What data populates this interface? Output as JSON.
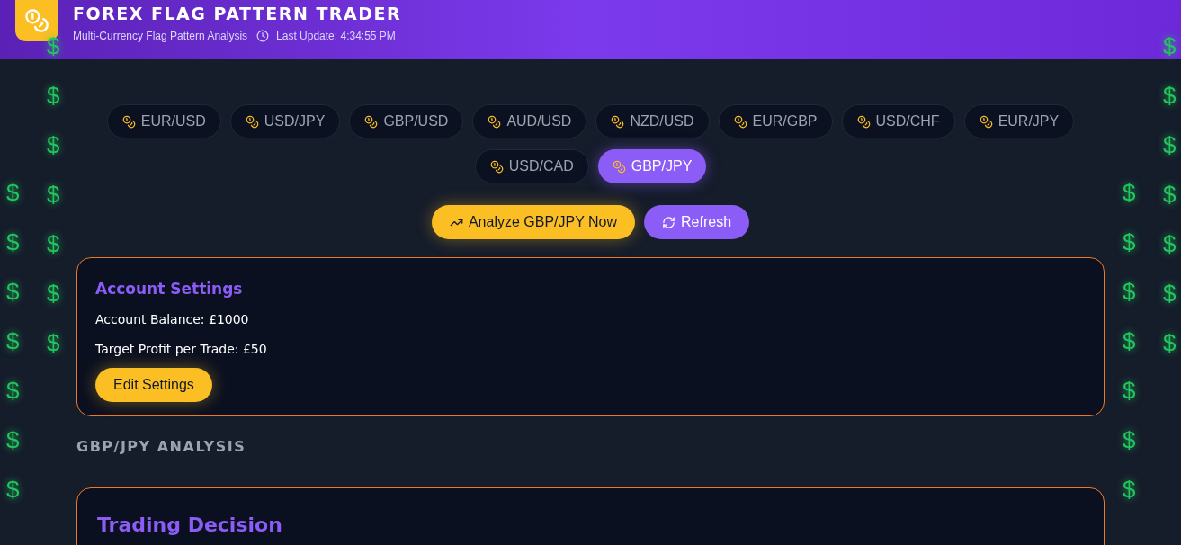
{
  "header": {
    "title": "FOREX FLAG PATTERN TRADER",
    "subtitle": "Multi-Currency Flag Pattern Analysis",
    "last_update": "Last Update: 4:34:55 PM"
  },
  "pairs": [
    {
      "label": "EUR/USD",
      "selected": false
    },
    {
      "label": "USD/JPY",
      "selected": false
    },
    {
      "label": "GBP/USD",
      "selected": false
    },
    {
      "label": "AUD/USD",
      "selected": false
    },
    {
      "label": "NZD/USD",
      "selected": false
    },
    {
      "label": "EUR/GBP",
      "selected": false
    },
    {
      "label": "USD/CHF",
      "selected": false
    },
    {
      "label": "EUR/JPY",
      "selected": false
    },
    {
      "label": "USD/CAD",
      "selected": false
    },
    {
      "label": "GBP/JPY",
      "selected": true
    }
  ],
  "actions": {
    "analyze": "Analyze GBP/JPY Now",
    "refresh": "Refresh"
  },
  "account_settings": {
    "title": "Account Settings",
    "balance": "Account Balance: £1000",
    "target": "Target Profit per Trade: £50",
    "edit": "Edit Settings"
  },
  "analysis_heading": "GBP/JPY ANALYSIS",
  "decision": {
    "title": "Trading Decision"
  },
  "dollar_columns": [
    {
      "symbols": [
        "$",
        "$",
        "$",
        "$",
        "$",
        "$",
        "$"
      ]
    },
    {
      "symbols": [
        "$",
        "$",
        "$",
        "$",
        "$",
        "$",
        "$"
      ]
    },
    {
      "symbols": [
        "$",
        "$",
        "$",
        "$",
        "$",
        "$",
        "$"
      ]
    },
    {
      "symbols": [
        "$",
        "$",
        "$",
        "$",
        "$",
        "$",
        "$"
      ]
    }
  ]
}
